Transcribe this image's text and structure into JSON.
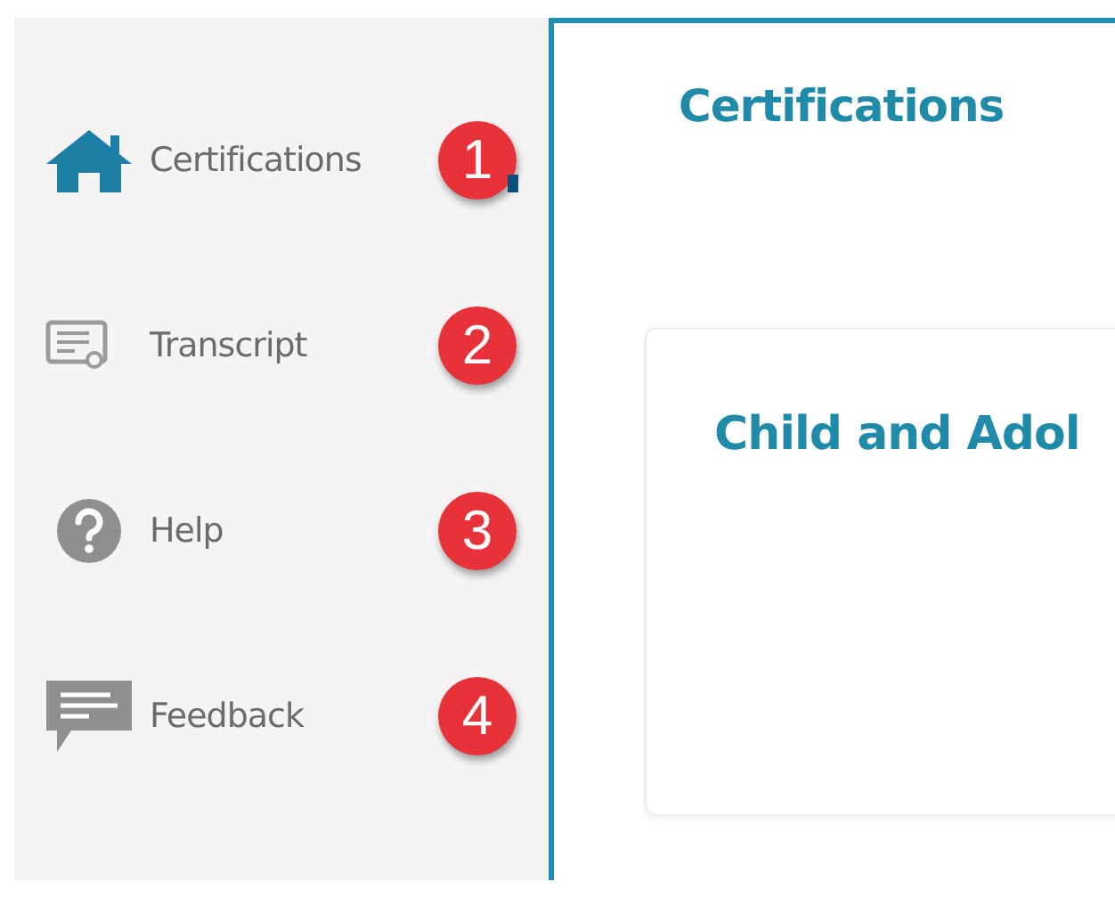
{
  "sidebar": {
    "items": [
      {
        "kind": "home",
        "label": "Certifications",
        "selected": true,
        "badge": "1"
      },
      {
        "kind": "transcript",
        "label": "Transcript",
        "selected": false,
        "badge": "2"
      },
      {
        "kind": "help",
        "label": "Help",
        "selected": false,
        "badge": "3"
      },
      {
        "kind": "feedback",
        "label": "Feedback",
        "selected": false,
        "badge": "4"
      }
    ]
  },
  "main": {
    "title": "Certifications",
    "card": {
      "title": "Child and Adol"
    }
  }
}
